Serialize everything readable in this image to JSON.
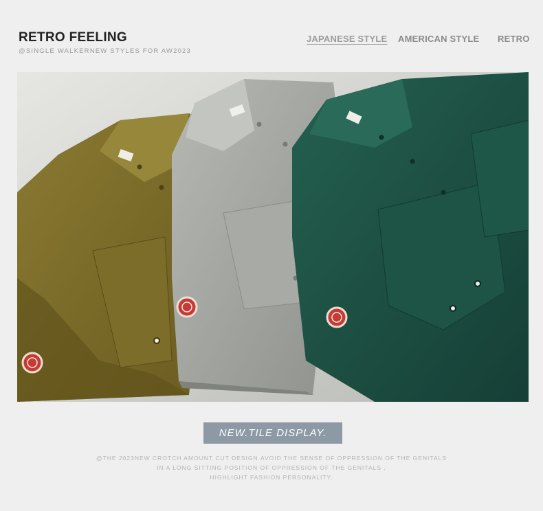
{
  "header": {
    "title": "RETRO FEELING",
    "subtitle": "@SINGLE WALKERNEW STYLES FOR AW2023",
    "nav": [
      {
        "label": "JAPANESE STYLE",
        "active": true
      },
      {
        "label": "AMERICAN STYLE",
        "active": false
      },
      {
        "label": "RETRO",
        "active": false
      }
    ]
  },
  "photo": {
    "colors": {
      "olive": "#7a6a28",
      "grey": "#a4a6a2",
      "teal": "#1f5448",
      "patch": "#c73a36"
    }
  },
  "badge": {
    "label": "NEW.TILE DISPLAY.",
    "color": "#8d99a4"
  },
  "footer": {
    "lines": [
      "@THE 2023NEW CROTCH AMOUNT CUT DESIGN.AVOID THE SENSE OF OPPRESSION OF THE GENITALS",
      "IN A LONG SITTING POSITION OF OPPRESSION OF THE GENITALS .",
      "HIGHLIGHT FASHION PERSONALITY."
    ]
  }
}
